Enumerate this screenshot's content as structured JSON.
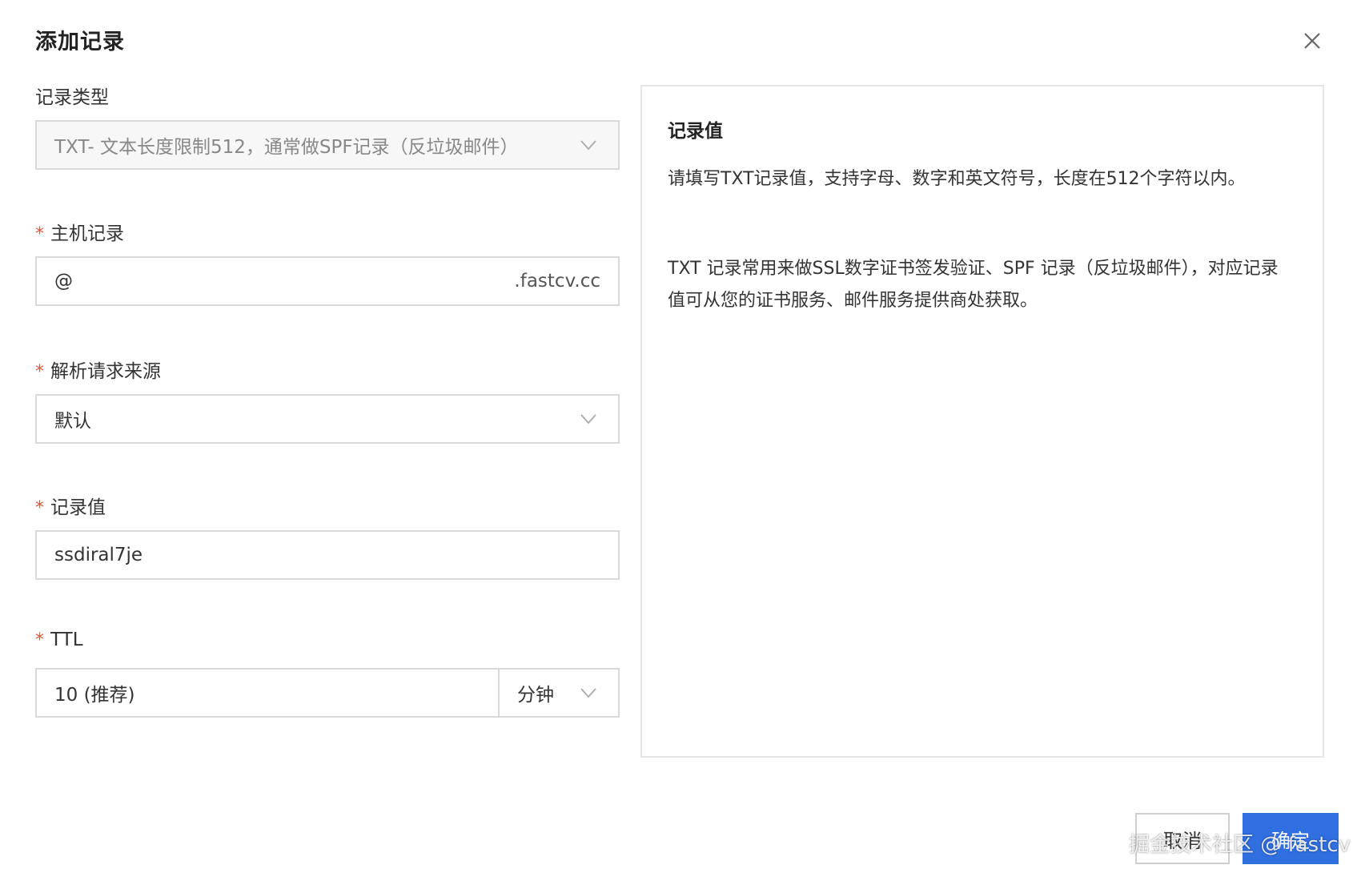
{
  "dialog": {
    "title": "添加记录"
  },
  "form": {
    "record_type": {
      "label": "记录类型",
      "value": "TXT- 文本长度限制512，通常做SPF记录（反垃圾邮件）"
    },
    "host": {
      "required_mark": "*",
      "label": "主机记录",
      "value": "@",
      "suffix": ".fastcv.cc"
    },
    "resolve_source": {
      "required_mark": "*",
      "label": "解析请求来源",
      "value": "默认"
    },
    "record_value": {
      "required_mark": "*",
      "label": "记录值",
      "value": "ssdiral7je"
    },
    "ttl": {
      "required_mark": "*",
      "label": "TTL",
      "value": "10 (推荐)",
      "unit": "分钟"
    }
  },
  "help": {
    "title": "记录值",
    "paragraph1": "请填写TXT记录值，支持字母、数字和英文符号，长度在512个字符以内。",
    "paragraph2": "TXT 记录常用来做SSL数字证书签发验证、SPF 记录（反垃圾邮件），对应记录值可从您的证书服务、邮件服务提供商处获取。"
  },
  "buttons": {
    "cancel": "取消",
    "ok": "确定"
  },
  "watermark": "掘金技术社区 @ fastcv",
  "colors": {
    "primary": "#2f6fe0",
    "required": "#e1533b",
    "border": "#d9d9d9"
  },
  "icons": [
    "close-icon",
    "chevron-down-icon"
  ]
}
